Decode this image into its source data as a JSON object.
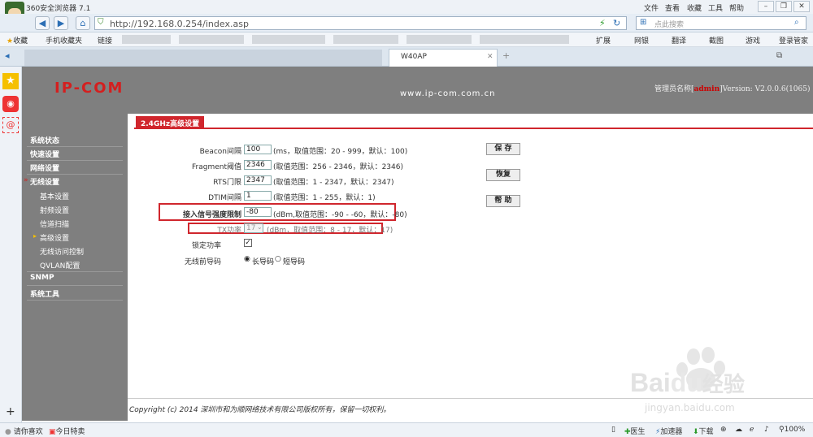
{
  "browser": {
    "title": "360安全浏览器 7.1",
    "menu": [
      "文件",
      "查看",
      "收藏",
      "工具",
      "帮助"
    ],
    "address": "http://192.168.0.254/index.asp",
    "search_placeholder": "点此搜索",
    "bookmarks": {
      "fav": "收藏",
      "mobile": "手机收藏夹",
      "links": "链接",
      "ext": "扩展",
      "bank": "网银",
      "translate": "翻译",
      "screenshot": "截图",
      "game": "游戏",
      "login": "登录管家"
    },
    "tab_title": "W40AP",
    "status": {
      "report": "请你喜欢",
      "today": "今日特卖",
      "doctor": "医生",
      "accelerator": "加速器",
      "download": "下载",
      "zoom": "100%"
    }
  },
  "router": {
    "logo": "IP-COM",
    "website": "www.ip-com.com.cn",
    "admin_label": "管理员名称",
    "admin_name": "admin",
    "version": "Version: V2.0.0.6(1065)",
    "menu": [
      {
        "label": "系统状态"
      },
      {
        "label": "快速设置"
      },
      {
        "label": "网络设置"
      },
      {
        "label": "无线设置"
      },
      {
        "label": "基本设置"
      },
      {
        "label": "射频设置"
      },
      {
        "label": "信道扫描"
      },
      {
        "label": "高级设置"
      },
      {
        "label": "无线访问控制"
      },
      {
        "label": "QVLAN配置"
      },
      {
        "label": "SNMP"
      },
      {
        "label": "系统工具"
      }
    ],
    "section_title": "2.4GHz高级设置",
    "fields": [
      {
        "label": "Beacon间隔",
        "value": "100",
        "hint": "(ms，取值范围：20 - 999，默认：100)"
      },
      {
        "label": "Fragment阈值",
        "value": "2346",
        "hint": "(取值范围：256 - 2346，默认：2346)"
      },
      {
        "label": "RTS门限",
        "value": "2347",
        "hint": "(取值范围：1 - 2347，默认：2347)"
      },
      {
        "label": "DTIM间隔",
        "value": "1",
        "hint": "(取值范围：1 - 255，默认：1)"
      },
      {
        "label": "接入信号强度限制",
        "value": "-80",
        "hint": "(dBm,取值范围：-90 - -60，默认：-80)"
      },
      {
        "label": "TX功率",
        "value": "17",
        "hint": "(dBm，取值范围：8 - 17，默认：17)"
      }
    ],
    "lock_power_label": "锁定功率",
    "preamble_label": "无线前导码",
    "preamble_long": "长导码",
    "preamble_short": "短导码",
    "buttons": {
      "save": "保 存",
      "restore": "恢复",
      "help": "帮 助"
    },
    "copyright": "Copyright (c) 2014 深圳市和为顺网络技术有限公司版权所有，保留一切权利。"
  },
  "watermark": {
    "brand": "Bai",
    "brand_cn": "经验",
    "url": "jingyan.baidu.com"
  }
}
